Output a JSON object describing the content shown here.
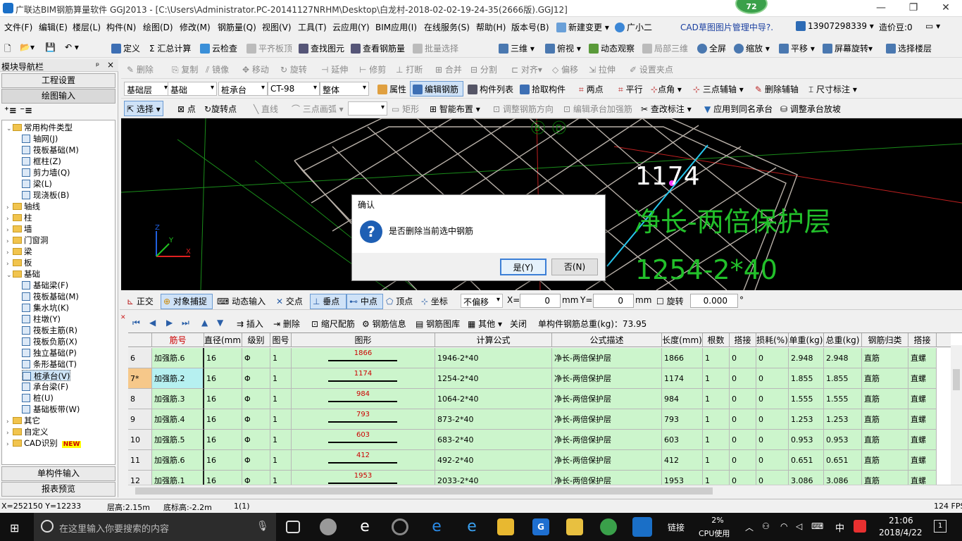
{
  "title": {
    "text": "广联达BIM钢筋算量软件 GGJ2013 - [C:\\Users\\Administrator.PC-20141127NRHM\\Desktop\\白龙村-2018-02-02-19-24-35(2666版).GGJ12]",
    "badge": "72",
    "min": "—",
    "restore": "❐",
    "close": "✕"
  },
  "menu": {
    "items": [
      "文件(F)",
      "编辑(E)",
      "楼层(L)",
      "构件(N)",
      "绘图(D)",
      "修改(M)",
      "钢筋量(Q)",
      "视图(V)",
      "工具(T)",
      "云应用(Y)",
      "BIM应用(I)",
      "在线服务(S)",
      "帮助(H)",
      "版本号(B)"
    ],
    "new_change": "新建变更",
    "guangxiaoer": "广小二",
    "cad_manager": "CAD草图图片管理中导?.",
    "phone": "13907298339",
    "price": "造价豆:0"
  },
  "toolbar1": [
    "定义",
    "Σ 汇总计算",
    "云检查",
    "平齐板顶",
    "查找图元",
    "查看钢筋量",
    "批量选择",
    "三维",
    "俯视",
    "动态观察",
    "局部三维",
    "全屏",
    "缩放",
    "平移",
    "屏幕旋转",
    "选择楼层"
  ],
  "toolbar2": [
    "删除",
    "复制",
    "镜像",
    "移动",
    "旋转",
    "延伸",
    "修剪",
    "打断",
    "合并",
    "分割",
    "对齐",
    "偏移",
    "拉伸",
    "设置夹点"
  ],
  "toolbar3": {
    "selects": [
      "基础层",
      "基础",
      "桩承台",
      "CT-98",
      "整体"
    ],
    "items": [
      "属性",
      "编辑钢筋",
      "构件列表",
      "拾取构件",
      "两点",
      "平行",
      "点角",
      "三点辅轴",
      "删除辅轴",
      "尺寸标注"
    ]
  },
  "toolbar4": [
    "选择",
    "点",
    "旋转点",
    "直线",
    "三点画弧",
    "矩形",
    "智能布置",
    "调整钢筋方向",
    "编辑承台加强筋",
    "查改标注",
    "应用到同名承台",
    "调整承台放坡"
  ],
  "nav": {
    "title": "模块导航栏",
    "pin": "ᵖ",
    "close": "×",
    "project_settings": "工程设置",
    "drawing_input": "绘图输入",
    "single_input": "单构件输入",
    "report_preview": "报表预览",
    "tree": [
      {
        "label": "常用构件类型",
        "level": 0,
        "kind": "folder",
        "exp": "−"
      },
      {
        "label": "轴网(J)",
        "level": 1,
        "kind": "item"
      },
      {
        "label": "筏板基础(M)",
        "level": 1,
        "kind": "item"
      },
      {
        "label": "框柱(Z)",
        "level": 1,
        "kind": "item"
      },
      {
        "label": "剪力墙(Q)",
        "level": 1,
        "kind": "item"
      },
      {
        "label": "梁(L)",
        "level": 1,
        "kind": "item"
      },
      {
        "label": "现浇板(B)",
        "level": 1,
        "kind": "item"
      },
      {
        "label": "轴线",
        "level": 0,
        "kind": "folder",
        "exp": "+"
      },
      {
        "label": "柱",
        "level": 0,
        "kind": "folder",
        "exp": "+"
      },
      {
        "label": "墙",
        "level": 0,
        "kind": "folder",
        "exp": "+"
      },
      {
        "label": "门窗洞",
        "level": 0,
        "kind": "folder",
        "exp": "+"
      },
      {
        "label": "梁",
        "level": 0,
        "kind": "folder",
        "exp": "+"
      },
      {
        "label": "板",
        "level": 0,
        "kind": "folder",
        "exp": "+"
      },
      {
        "label": "基础",
        "level": 0,
        "kind": "folder",
        "exp": "−"
      },
      {
        "label": "基础梁(F)",
        "level": 1,
        "kind": "item"
      },
      {
        "label": "筏板基础(M)",
        "level": 1,
        "kind": "item"
      },
      {
        "label": "集水坑(K)",
        "level": 1,
        "kind": "item"
      },
      {
        "label": "柱墩(Y)",
        "level": 1,
        "kind": "item"
      },
      {
        "label": "筏板主筋(R)",
        "level": 1,
        "kind": "item"
      },
      {
        "label": "筏板负筋(X)",
        "level": 1,
        "kind": "item"
      },
      {
        "label": "独立基础(P)",
        "level": 1,
        "kind": "item"
      },
      {
        "label": "条形基础(T)",
        "level": 1,
        "kind": "item"
      },
      {
        "label": "桩承台(V)",
        "level": 1,
        "kind": "item",
        "selected": true
      },
      {
        "label": "承台梁(F)",
        "level": 1,
        "kind": "item"
      },
      {
        "label": "桩(U)",
        "level": 1,
        "kind": "item"
      },
      {
        "label": "基础板带(W)",
        "level": 1,
        "kind": "item"
      },
      {
        "label": "其它",
        "level": 0,
        "kind": "folder",
        "exp": "+"
      },
      {
        "label": "自定义",
        "level": 0,
        "kind": "folder",
        "exp": "+"
      },
      {
        "label": "CAD识别",
        "level": 0,
        "kind": "folder",
        "exp": "+",
        "tag": "NEW"
      }
    ]
  },
  "canvas": {
    "axis_b": "B",
    "axis_d": "D",
    "length_label": "1174",
    "desc_label": "净长-两倍保护层",
    "formula_label": "1254-2*40"
  },
  "dialog": {
    "title": "确认",
    "icon": "?",
    "message": "是否删除当前选中钢筋",
    "yes": "是(Y)",
    "no": "否(N)"
  },
  "snapbar": {
    "items": [
      "正交",
      "对象捕捉",
      "动态输入",
      "交点",
      "垂点",
      "中点",
      "顶点",
      "坐标"
    ],
    "offset": "不偏移",
    "x_label": "X=",
    "x_value": "0",
    "y_label": "Y=",
    "y_value": "0",
    "unit": "mm",
    "rotate": "旋转",
    "rotate_value": "0.000",
    "degree": "°"
  },
  "gridbar": {
    "items": [
      "插入",
      "删除",
      "缩尺配筋",
      "钢筋信息",
      "钢筋图库",
      "其他",
      "关闭"
    ],
    "total": "单构件钢筋总重(kg)：73.95"
  },
  "table": {
    "columns": [
      "",
      "筋号",
      "直径(mm)",
      "级别",
      "图号",
      "图形",
      "计算公式",
      "公式描述",
      "长度(mm)",
      "根数",
      "搭接",
      "损耗(%)",
      "单重(kg)",
      "总重(kg)",
      "钢筋归类",
      "搭接"
    ],
    "rows": [
      {
        "no": "6",
        "name": "加强筋.6",
        "dia": "16",
        "grade": "Φ",
        "fig": "1",
        "shape": "1866",
        "formula": "1946-2*40",
        "desc": "净长-两倍保护层",
        "len": "1866",
        "count": "1",
        "lap": "0",
        "loss": "0",
        "unit": "2.948",
        "total": "2.948",
        "cls": "直筋",
        "lap2": "直螺"
      },
      {
        "no": "7*",
        "name": "加强筋.2",
        "dia": "16",
        "grade": "Φ",
        "fig": "1",
        "shape": "1174",
        "formula": "1254-2*40",
        "desc": "净长-两倍保护层",
        "len": "1174",
        "count": "1",
        "lap": "0",
        "loss": "0",
        "unit": "1.855",
        "total": "1.855",
        "cls": "直筋",
        "lap2": "直螺"
      },
      {
        "no": "8",
        "name": "加强筋.3",
        "dia": "16",
        "grade": "Φ",
        "fig": "1",
        "shape": "984",
        "formula": "1064-2*40",
        "desc": "净长-两倍保护层",
        "len": "984",
        "count": "1",
        "lap": "0",
        "loss": "0",
        "unit": "1.555",
        "total": "1.555",
        "cls": "直筋",
        "lap2": "直螺"
      },
      {
        "no": "9",
        "name": "加强筋.4",
        "dia": "16",
        "grade": "Φ",
        "fig": "1",
        "shape": "793",
        "formula": "873-2*40",
        "desc": "净长-两倍保护层",
        "len": "793",
        "count": "1",
        "lap": "0",
        "loss": "0",
        "unit": "1.253",
        "total": "1.253",
        "cls": "直筋",
        "lap2": "直螺"
      },
      {
        "no": "10",
        "name": "加强筋.5",
        "dia": "16",
        "grade": "Φ",
        "fig": "1",
        "shape": "603",
        "formula": "683-2*40",
        "desc": "净长-两倍保护层",
        "len": "603",
        "count": "1",
        "lap": "0",
        "loss": "0",
        "unit": "0.953",
        "total": "0.953",
        "cls": "直筋",
        "lap2": "直螺"
      },
      {
        "no": "11",
        "name": "加强筋.6",
        "dia": "16",
        "grade": "Φ",
        "fig": "1",
        "shape": "412",
        "formula": "492-2*40",
        "desc": "净长-两倍保护层",
        "len": "412",
        "count": "1",
        "lap": "0",
        "loss": "0",
        "unit": "0.651",
        "total": "0.651",
        "cls": "直筋",
        "lap2": "直螺"
      },
      {
        "no": "12",
        "name": "加强筋.1",
        "dia": "16",
        "grade": "Φ",
        "fig": "1",
        "shape": "1953",
        "formula": "2033-2*40",
        "desc": "净长-两倍保护层",
        "len": "1953",
        "count": "1",
        "lap": "0",
        "loss": "0",
        "unit": "3.086",
        "total": "3.086",
        "cls": "直筋",
        "lap2": "直螺"
      }
    ]
  },
  "status": {
    "coords": "X=252150 Y=12233",
    "floor_h": "层高:2.15m",
    "bottom_h": "底标高:-2.2m",
    "count": "1(1)",
    "fps": "124 FPS"
  },
  "taskbar": {
    "search_placeholder": "在这里输入你要搜索的内容",
    "link": "链接",
    "cpu_pct": "2%",
    "cpu_label": "CPU使用",
    "ime": "中",
    "time": "21:06",
    "date": "2018/4/22",
    "notify": "1"
  },
  "colors": {
    "accent": "#1a6fc7",
    "table_bg": "#ccf5cc",
    "canvas_green": "#22c02a",
    "selected_row": "#f6c88a"
  }
}
